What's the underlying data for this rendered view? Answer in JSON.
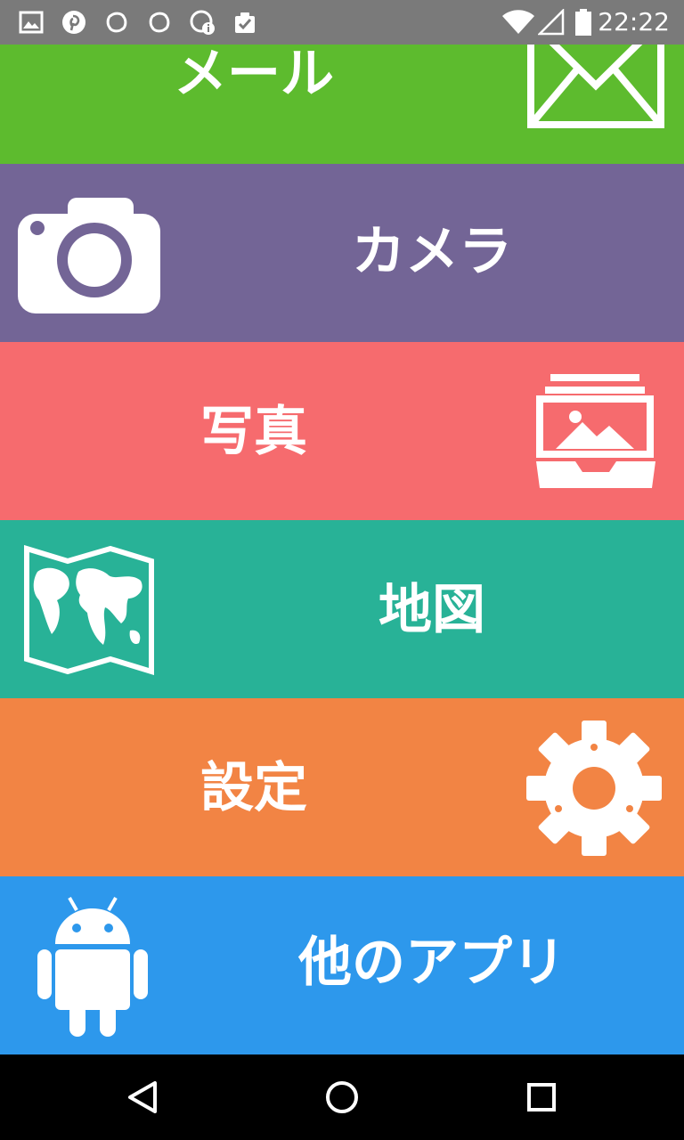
{
  "status_bar": {
    "time": "22:22",
    "left_icons": [
      "gallery-icon",
      "pinterest-icon",
      "sync-icon",
      "sync-icon",
      "info-icon",
      "clipboard-check-icon"
    ],
    "right_icons": [
      "wifi-icon",
      "cell-signal-icon",
      "battery-icon"
    ]
  },
  "tiles": [
    {
      "id": "mail",
      "label": "メール",
      "color": "#5dbb2e",
      "icon": "envelope-icon"
    },
    {
      "id": "camera",
      "label": "カメラ",
      "color": "#736596",
      "icon": "camera-icon"
    },
    {
      "id": "photo",
      "label": "写真",
      "color": "#f66b6e",
      "icon": "photo-gallery-icon"
    },
    {
      "id": "map",
      "label": "地図",
      "color": "#28b297",
      "icon": "world-map-icon"
    },
    {
      "id": "settings",
      "label": "設定",
      "color": "#f28444",
      "icon": "gear-icon"
    },
    {
      "id": "apps",
      "label": "他のアプリ",
      "color": "#2d98ec",
      "icon": "android-icon"
    }
  ],
  "nav_bar": {
    "buttons": [
      "back-icon",
      "home-icon",
      "recents-icon"
    ]
  }
}
